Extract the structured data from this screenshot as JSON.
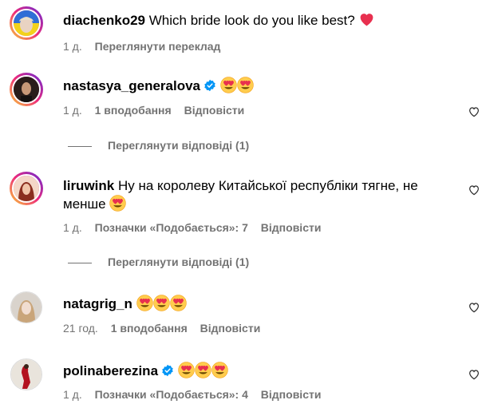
{
  "comments": [
    {
      "username": "diachenko29",
      "text": "Which bride look do you like best?",
      "time": "1 д.",
      "translate_label": "Переглянути переклад"
    },
    {
      "username": "nastasya_generalova",
      "time": "1 д.",
      "likes": "1 вподобання",
      "reply_label": "Відповісти",
      "view_replies": "Переглянути відповіді (1)"
    },
    {
      "username": "liruwink",
      "text_line1": "Ну на королеву Китайської республіки тягне, не",
      "text_line2": "менше",
      "time": "1 д.",
      "likes": "Позначки «Подобається»: 7",
      "reply_label": "Відповісти",
      "view_replies": "Переглянути відповіді (1)"
    },
    {
      "username": "natagrig_n",
      "time": "21 год.",
      "likes": "1 вподобання",
      "reply_label": "Відповісти"
    },
    {
      "username": "polinaberezina",
      "time": "1 д.",
      "likes": "Позначки «Подобається»: 4",
      "reply_label": "Відповісти"
    }
  ],
  "icons": {
    "heart_emoji": "red-heart-emoji",
    "eyes_emoji": "heart-eyes-emoji",
    "verified": "verified-badge-icon",
    "like": "heart-outline-icon"
  },
  "colors": {
    "verified": "#0095f6",
    "secondary_text": "#737373",
    "emoji_heart": "#e8304f"
  }
}
